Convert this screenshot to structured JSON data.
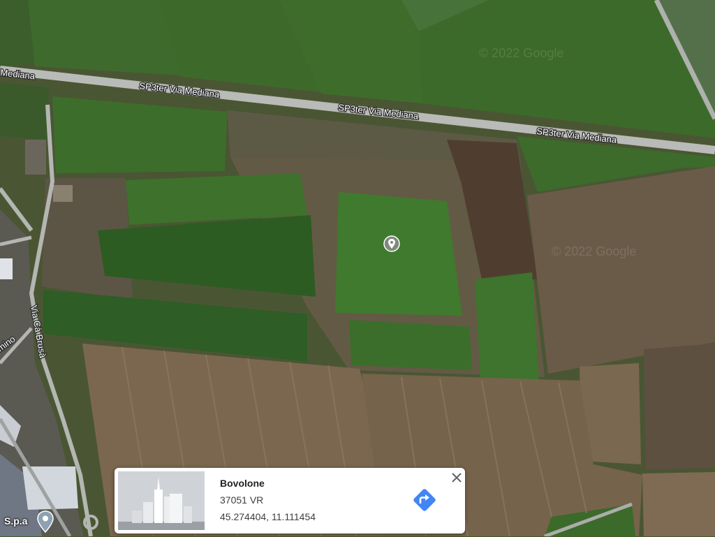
{
  "map": {
    "type": "satellite",
    "roads": {
      "main_label": "SP3ter Via Mediana",
      "main_label_left": "Mediana",
      "side_label": "Via Cà Brusà",
      "side_label_2": "mino"
    },
    "watermark": "© 2022 Google",
    "colors": {
      "field_green": "#3e6b2c",
      "field_dark_green": "#2f5a22",
      "field_brown": "#7a664c",
      "road": "#b8bab6"
    }
  },
  "selected_pin": {
    "icon": "location-pin-icon"
  },
  "poi": {
    "label": "S.p.a",
    "icon": "poi-pin-icon"
  },
  "info_card": {
    "title": "Bovolone",
    "line1": "37051 VR",
    "coords": "45.274404, 11.111454",
    "directions_icon": "directions-icon",
    "close_icon": "close-icon",
    "accent": "#4285f4"
  }
}
